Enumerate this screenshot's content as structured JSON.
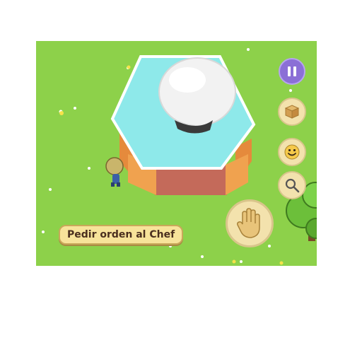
{
  "game": {
    "action_prompt": "Pedir orden al Chef"
  },
  "hud": {
    "pause_icon": "pause-icon",
    "side_buttons": [
      "box-icon",
      "smiley-face-icon",
      "magnifier-icon"
    ],
    "interact_icon": "hand-icon"
  },
  "colors": {
    "grass": "#8dd14a",
    "water": "#8ee9ea",
    "pause": "#8b6fd6",
    "button": "#f3e2ad",
    "label_bg": "#f7e39a",
    "label_text": "#4a2f1e"
  }
}
